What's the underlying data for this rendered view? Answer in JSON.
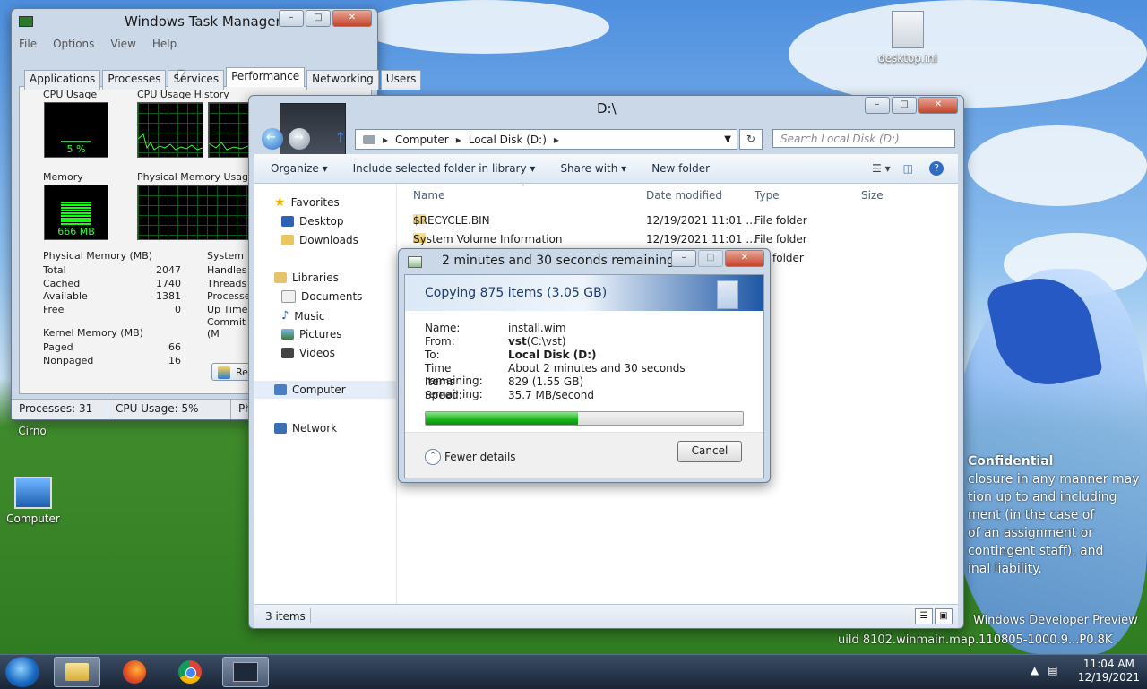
{
  "desktop": {
    "icons": [
      {
        "label": "desktop.ini"
      },
      {
        "label": "Cirno"
      },
      {
        "label": "Computer"
      }
    ],
    "watermark": {
      "title": "Confidential",
      "lines": [
        "closure in any manner may",
        "tion up to and including",
        "ment (in the case of",
        "of an assignment or",
        "contingent staff), and",
        "inal liability."
      ]
    },
    "dev_preview": "Windows Developer Preview",
    "build": "uild 8102.winmain.map.110805-1000.9...P0.8K"
  },
  "taskmgr": {
    "title": "Windows Task Manager",
    "menu": [
      "File",
      "Options",
      "View",
      "Help"
    ],
    "tabs": [
      "Applications",
      "Processes",
      "Services",
      "Performance",
      "Networking",
      "Users"
    ],
    "active_tab": "Performance",
    "cpu_usage_label": "CPU Usage",
    "cpu_usage_value": "5 %",
    "cpu_usage_pct": 5,
    "cpu_history_label": "CPU Usage History",
    "memory_label": "Memory",
    "memory_value": "666 MB",
    "phys_history_label": "Physical Memory Usage Hi",
    "phys_mem": {
      "title": "Physical Memory (MB)",
      "rows": [
        {
          "k": "Total",
          "v": "2047"
        },
        {
          "k": "Cached",
          "v": "1740"
        },
        {
          "k": "Available",
          "v": "1381"
        },
        {
          "k": "Free",
          "v": "0"
        }
      ]
    },
    "system": {
      "title": "System",
      "rows": [
        "Handles",
        "Threads",
        "Processes",
        "Up Time",
        "Commit (M"
      ]
    },
    "kernel_mem": {
      "title": "Kernel Memory (MB)",
      "rows": [
        {
          "k": "Paged",
          "v": "66"
        },
        {
          "k": "Nonpaged",
          "v": "16"
        }
      ]
    },
    "resmon_label": "Re",
    "status": [
      "Processes: 31",
      "CPU Usage: 5%",
      "Phy"
    ]
  },
  "explorer": {
    "title": "D:\\",
    "address": [
      "Computer",
      "Local Disk (D:)"
    ],
    "search_placeholder": "Search Local Disk (D:)",
    "toolbar": [
      "Organize",
      "Include selected folder in library",
      "Share with",
      "New folder"
    ],
    "nav": {
      "favorites": "Favorites",
      "desktop": "Desktop",
      "downloads": "Downloads",
      "libraries": "Libraries",
      "documents": "Documents",
      "music": "Music",
      "pictures": "Pictures",
      "videos": "Videos",
      "computer": "Computer",
      "network": "Network"
    },
    "columns": [
      "Name",
      "Date modified",
      "Type",
      "Size"
    ],
    "files": [
      {
        "name": "$RECYCLE.BIN",
        "date": "12/19/2021 11:01 ...",
        "type": "File folder"
      },
      {
        "name": "System Volume Information",
        "date": "12/19/2021 11:01 ...",
        "type": "File folder"
      },
      {
        "name": "",
        "date": "",
        "type": "folder"
      }
    ],
    "status": "3 items"
  },
  "copy": {
    "title": "2 minutes and 30 seconds remaining",
    "heading": "Copying 875 items (3.05 GB)",
    "name_k": "Name:",
    "name_v": "install.wim",
    "from_k": "From:",
    "from_v_bold": "vst",
    "from_v": " (C:\\vst)",
    "to_k": "To:",
    "to_v": "Local Disk (D:)",
    "time_k": "Time remaining:",
    "time_v": "About 2 minutes and 30 seconds",
    "items_k": "Items remaining:",
    "items_v": "829 (1.55 GB)",
    "speed_k": "Speed:",
    "speed_v": "35.7 MB/second",
    "progress_fraction": 0.48,
    "fewer": "Fewer details",
    "cancel": "Cancel"
  },
  "taskbar": {
    "time": "11:04 AM",
    "date": "12/19/2021"
  }
}
